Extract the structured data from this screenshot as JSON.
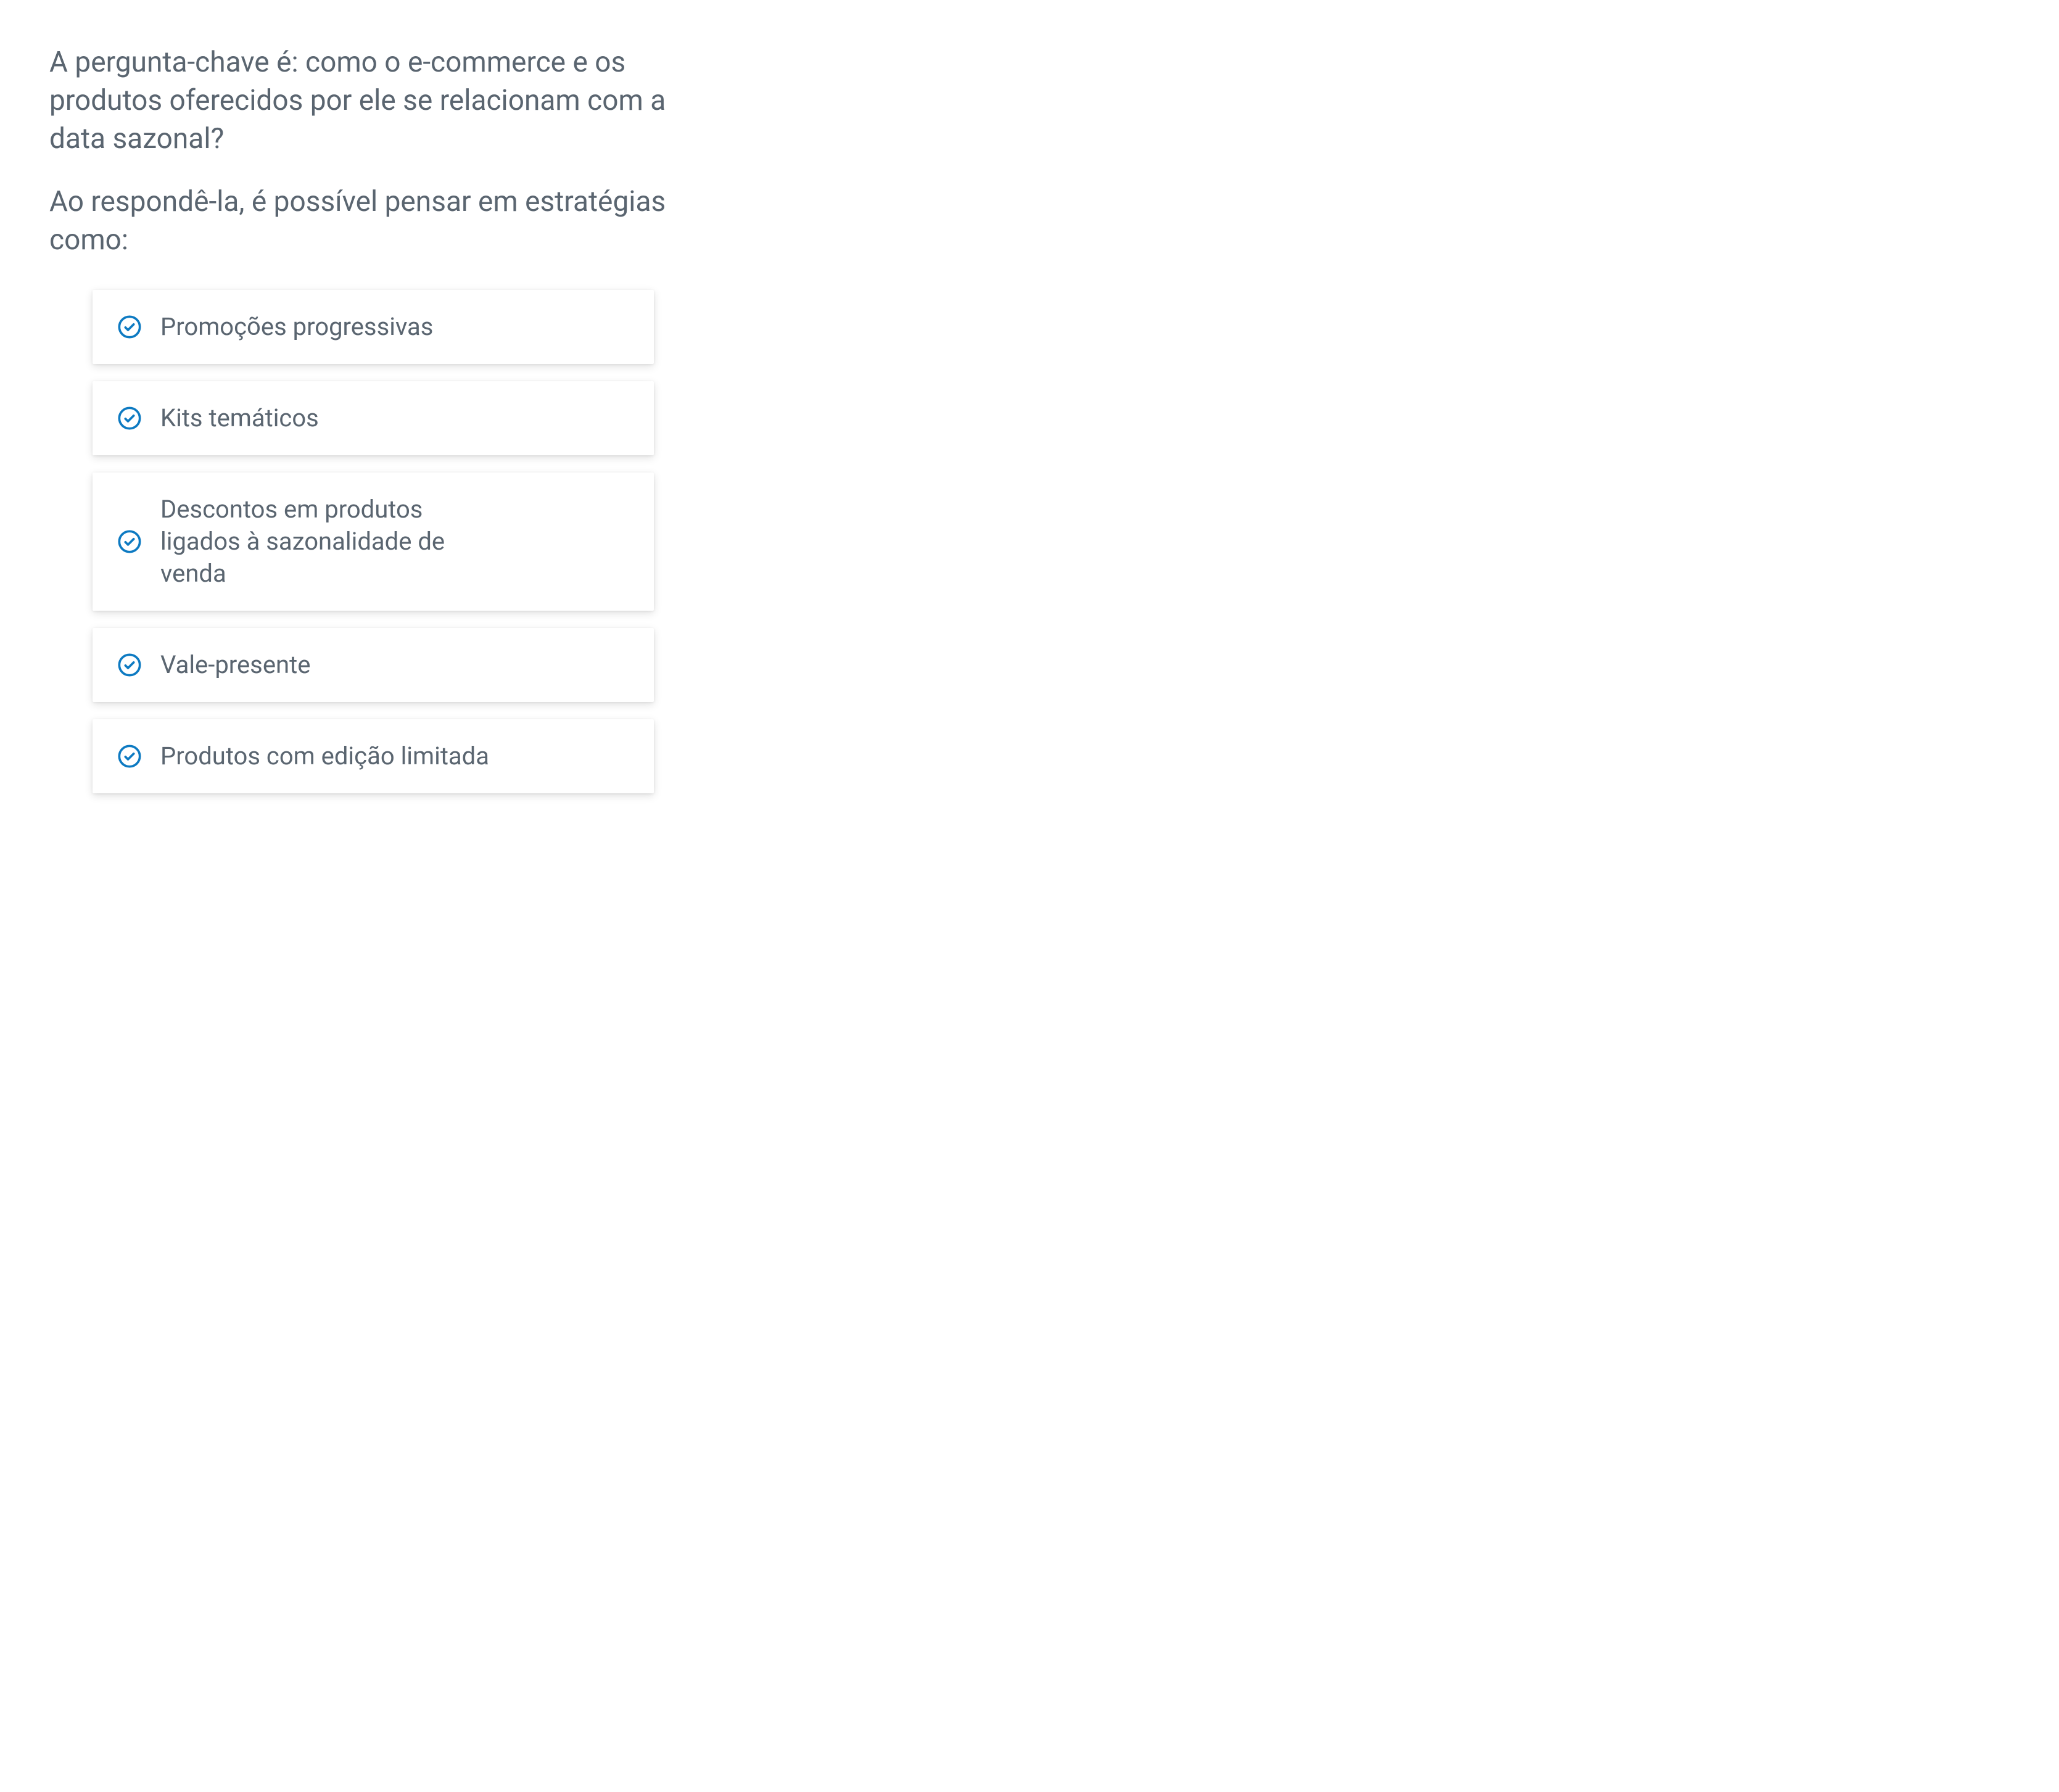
{
  "intro": {
    "p1": "A pergunta-chave é: como o e-commerce e os produtos oferecidos por ele se relacionam com a data sazonal?",
    "p2": "Ao respondê-la, é possível pensar em estratégias como:"
  },
  "cards": [
    {
      "label": "Promoções progressivas"
    },
    {
      "label": "Kits temáticos"
    },
    {
      "label": "Descontos em produtos ligados à sazonalidade de venda"
    },
    {
      "label": "Vale-presente"
    },
    {
      "label": "Produtos com edição limitada"
    }
  ],
  "colors": {
    "accent": "#0d7ac2",
    "text": "#5a6570"
  }
}
